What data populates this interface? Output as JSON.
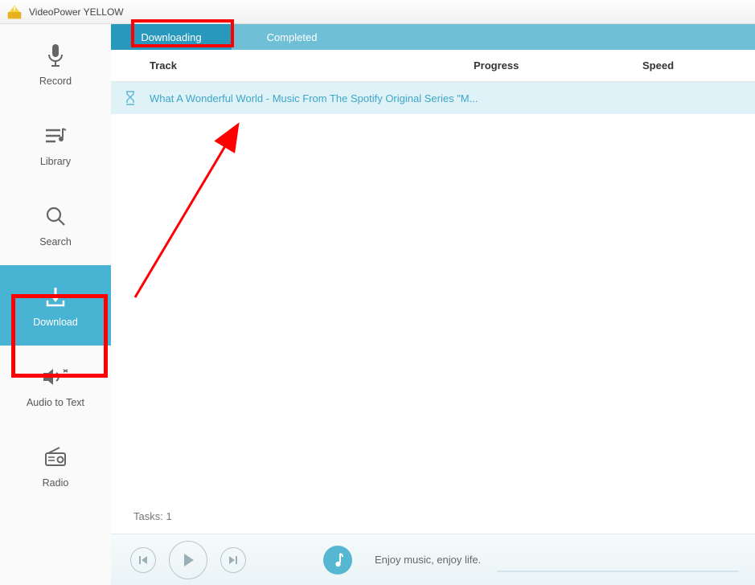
{
  "app": {
    "title": "VideoPower YELLOW"
  },
  "sidebar": {
    "items": [
      {
        "label": "Record"
      },
      {
        "label": "Library"
      },
      {
        "label": "Search"
      },
      {
        "label": "Download"
      },
      {
        "label": "Audio to Text"
      },
      {
        "label": "Radio"
      }
    ]
  },
  "tabs": {
    "items": [
      {
        "label": "Downloading"
      },
      {
        "label": "Completed"
      }
    ]
  },
  "columns": {
    "track": "Track",
    "progress": "Progress",
    "speed": "Speed"
  },
  "rows": [
    {
      "name": "What A Wonderful World - Music From The Spotify Original Series \"M..."
    }
  ],
  "footer": {
    "tasks": "Tasks: 1"
  },
  "player": {
    "tagline": "Enjoy music, enjoy life."
  }
}
